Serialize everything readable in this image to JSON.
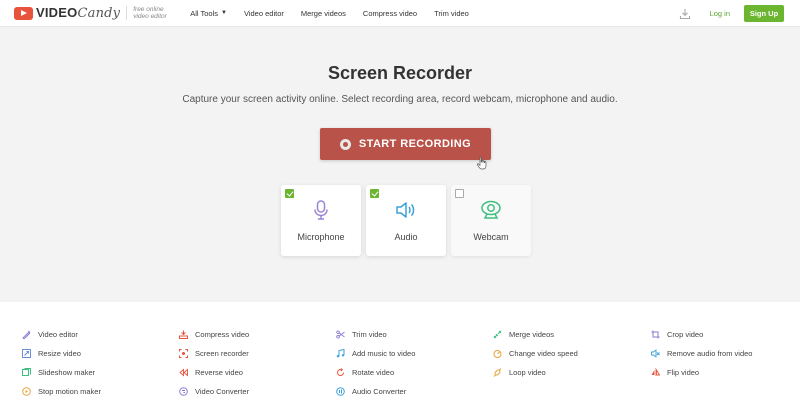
{
  "header": {
    "logo_brand": "VIDEO",
    "logo_candy": "Candy",
    "logo_sub_line1": "free online",
    "logo_sub_line2": "video editor",
    "nav": [
      "All Tools",
      "Video editor",
      "Merge videos",
      "Compress video",
      "Trim video"
    ],
    "login": "Log in",
    "signup": "Sign Up"
  },
  "hero": {
    "title": "Screen Recorder",
    "subtitle": "Capture your screen activity online. Select recording area, record webcam, microphone and audio.",
    "start_button": "START RECORDING"
  },
  "options": [
    {
      "label": "Microphone",
      "checked": true,
      "icon": "microphone-icon"
    },
    {
      "label": "Audio",
      "checked": true,
      "icon": "speaker-icon"
    },
    {
      "label": "Webcam",
      "checked": false,
      "icon": "webcam-icon"
    }
  ],
  "tools": [
    [
      "Video editor",
      "Resize video",
      "Slideshow maker",
      "Stop motion maker"
    ],
    [
      "Compress video",
      "Screen recorder",
      "Reverse video",
      "Video Converter"
    ],
    [
      "Trim video",
      "Add music to video",
      "Rotate video",
      "Audio Converter"
    ],
    [
      "Merge videos",
      "Change video speed",
      "Loop video"
    ],
    [
      "Crop video",
      "Remove audio from video",
      "Flip video"
    ]
  ],
  "colors": {
    "accent_green": "#6bb530",
    "record_button": "#b9534a",
    "logo_red": "#e8533c"
  }
}
